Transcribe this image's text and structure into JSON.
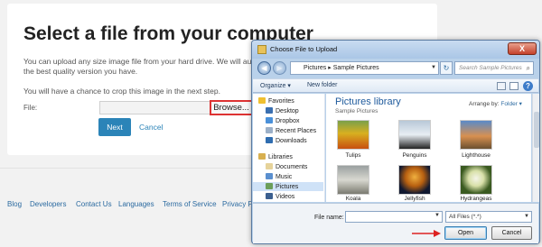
{
  "page": {
    "title": "Select a file from your computer",
    "line1": "You can upload any size image file from your hard drive. We will auto",
    "line2": "the best quality version you have.",
    "line3": "You will have a chance to crop this image in the next step.",
    "file_label": "File:",
    "browse_label": "Browse...",
    "next_label": "Next",
    "cancel_label": "Cancel"
  },
  "footer": {
    "links": [
      "Blog",
      "Developers",
      "Contact Us",
      "Languages",
      "Terms of Service",
      "Privacy P"
    ]
  },
  "dialog": {
    "title": "Choose File to Upload",
    "close_label": "X",
    "address": {
      "parts": [
        "Pictures",
        "Sample Pictures"
      ],
      "separator": "▸"
    },
    "search_placeholder": "Search Sample Pictures",
    "toolbar": {
      "organize": "Organize ▾",
      "new_folder": "New folder"
    },
    "nav": {
      "favorites": "Favorites",
      "items": [
        "Desktop",
        "Dropbox",
        "Recent Places",
        "Downloads"
      ],
      "libraries": "Libraries",
      "lib_items": [
        "Documents",
        "Music",
        "Pictures",
        "Videos"
      ],
      "selected": "Pictures"
    },
    "library": {
      "title": "Pictures library",
      "subtitle": "Sample Pictures",
      "arrange_label": "Arrange by:",
      "arrange_value": "Folder ▾"
    },
    "files": [
      "Tulips",
      "Penguins",
      "Lighthouse",
      "Koala",
      "Jellyfish",
      "Hydrangeas"
    ],
    "filename_label": "File name:",
    "filename_value": "",
    "filetype_value": "All Files (*.*)",
    "open_label": "Open",
    "cancel_label": "Cancel",
    "colors": {
      "accent_red": "#dd2222",
      "link": "#2b84b8",
      "library_blue": "#1e5a9c"
    }
  }
}
